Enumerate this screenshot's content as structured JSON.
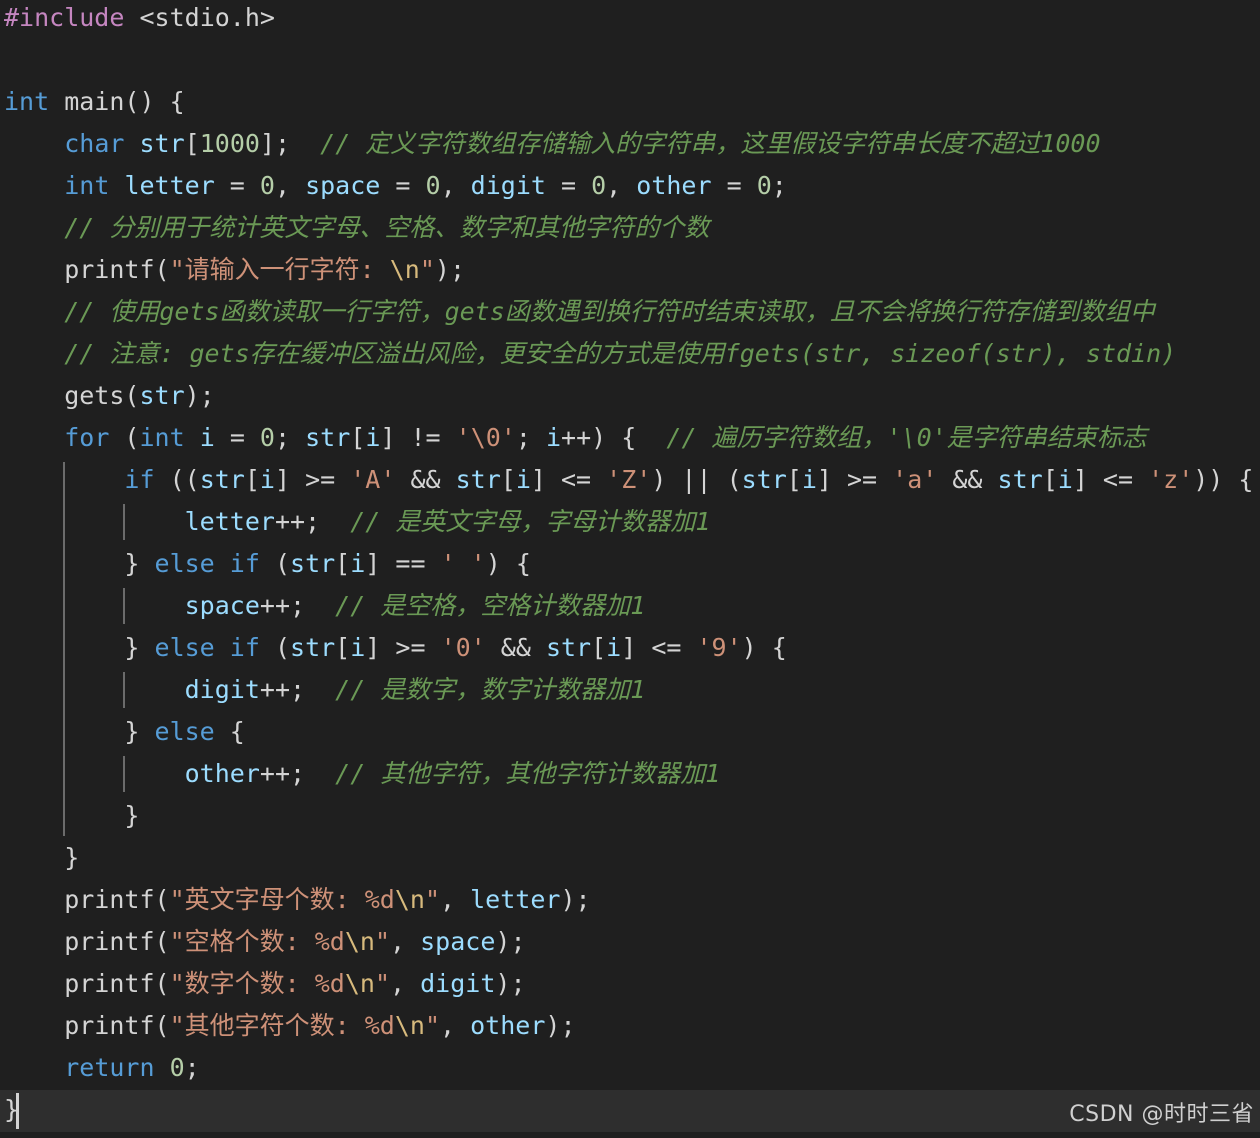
{
  "editor": {
    "lines": [
      [
        {
          "t": "#include",
          "c": "pp"
        },
        {
          "t": " ",
          "c": "plain"
        },
        {
          "t": "<stdio.h>",
          "c": "plain"
        }
      ],
      [],
      [
        {
          "t": "int",
          "c": "kw"
        },
        {
          "t": " main() ",
          "c": "plain"
        },
        {
          "t": "{",
          "c": "plain"
        }
      ],
      [
        {
          "t": "    ",
          "c": "plain"
        },
        {
          "t": "char",
          "c": "kw"
        },
        {
          "t": " ",
          "c": "plain"
        },
        {
          "t": "str",
          "c": "var"
        },
        {
          "t": "[",
          "c": "plain"
        },
        {
          "t": "1000",
          "c": "num"
        },
        {
          "t": "];  ",
          "c": "plain"
        },
        {
          "t": "// 定义字符数组存储输入的字符串，这里假设字符串长度不超过1000",
          "c": "cmt"
        }
      ],
      [
        {
          "t": "    ",
          "c": "plain"
        },
        {
          "t": "int",
          "c": "kw"
        },
        {
          "t": " ",
          "c": "plain"
        },
        {
          "t": "letter",
          "c": "var"
        },
        {
          "t": " = ",
          "c": "plain"
        },
        {
          "t": "0",
          "c": "num"
        },
        {
          "t": ", ",
          "c": "plain"
        },
        {
          "t": "space",
          "c": "var"
        },
        {
          "t": " = ",
          "c": "plain"
        },
        {
          "t": "0",
          "c": "num"
        },
        {
          "t": ", ",
          "c": "plain"
        },
        {
          "t": "digit",
          "c": "var"
        },
        {
          "t": " = ",
          "c": "plain"
        },
        {
          "t": "0",
          "c": "num"
        },
        {
          "t": ", ",
          "c": "plain"
        },
        {
          "t": "other",
          "c": "var"
        },
        {
          "t": " = ",
          "c": "plain"
        },
        {
          "t": "0",
          "c": "num"
        },
        {
          "t": ";",
          "c": "plain"
        }
      ],
      [
        {
          "t": "    ",
          "c": "plain"
        },
        {
          "t": "// 分别用于统计英文字母、空格、数字和其他字符的个数",
          "c": "cmt"
        }
      ],
      [
        {
          "t": "    printf(",
          "c": "plain"
        },
        {
          "t": "\"请输入一行字符: ",
          "c": "str"
        },
        {
          "t": "\\n",
          "c": "esc"
        },
        {
          "t": "\"",
          "c": "str"
        },
        {
          "t": ");",
          "c": "plain"
        }
      ],
      [
        {
          "t": "    ",
          "c": "plain"
        },
        {
          "t": "// 使用gets函数读取一行字符，gets函数遇到换行符时结束读取，且不会将换行符存储到数组中",
          "c": "cmt"
        }
      ],
      [
        {
          "t": "    ",
          "c": "plain"
        },
        {
          "t": "// 注意: gets存在缓冲区溢出风险，更安全的方式是使用fgets(str, sizeof(str), stdin)",
          "c": "cmt"
        }
      ],
      [
        {
          "t": "    gets(",
          "c": "plain"
        },
        {
          "t": "str",
          "c": "var"
        },
        {
          "t": ");",
          "c": "plain"
        }
      ],
      [
        {
          "t": "    ",
          "c": "plain"
        },
        {
          "t": "for",
          "c": "ctrl"
        },
        {
          "t": " (",
          "c": "plain"
        },
        {
          "t": "int",
          "c": "kw"
        },
        {
          "t": " ",
          "c": "plain"
        },
        {
          "t": "i",
          "c": "var"
        },
        {
          "t": " = ",
          "c": "plain"
        },
        {
          "t": "0",
          "c": "num"
        },
        {
          "t": "; ",
          "c": "plain"
        },
        {
          "t": "str",
          "c": "var"
        },
        {
          "t": "[",
          "c": "plain"
        },
        {
          "t": "i",
          "c": "var"
        },
        {
          "t": "] != ",
          "c": "plain"
        },
        {
          "t": "'\\0'",
          "c": "str"
        },
        {
          "t": "; ",
          "c": "plain"
        },
        {
          "t": "i",
          "c": "var"
        },
        {
          "t": "++) {  ",
          "c": "plain"
        },
        {
          "t": "// 遍历字符数组，'\\0'是字符串结束标志",
          "c": "cmt"
        }
      ],
      [
        {
          "t": "        ",
          "c": "plain"
        },
        {
          "t": "if",
          "c": "ctrl"
        },
        {
          "t": " ((",
          "c": "plain"
        },
        {
          "t": "str",
          "c": "var"
        },
        {
          "t": "[",
          "c": "plain"
        },
        {
          "t": "i",
          "c": "var"
        },
        {
          "t": "] >= ",
          "c": "plain"
        },
        {
          "t": "'A'",
          "c": "str"
        },
        {
          "t": " && ",
          "c": "plain"
        },
        {
          "t": "str",
          "c": "var"
        },
        {
          "t": "[",
          "c": "plain"
        },
        {
          "t": "i",
          "c": "var"
        },
        {
          "t": "] <= ",
          "c": "plain"
        },
        {
          "t": "'Z'",
          "c": "str"
        },
        {
          "t": ") || (",
          "c": "plain"
        },
        {
          "t": "str",
          "c": "var"
        },
        {
          "t": "[",
          "c": "plain"
        },
        {
          "t": "i",
          "c": "var"
        },
        {
          "t": "] >= ",
          "c": "plain"
        },
        {
          "t": "'a'",
          "c": "str"
        },
        {
          "t": " && ",
          "c": "plain"
        },
        {
          "t": "str",
          "c": "var"
        },
        {
          "t": "[",
          "c": "plain"
        },
        {
          "t": "i",
          "c": "var"
        },
        {
          "t": "] <= ",
          "c": "plain"
        },
        {
          "t": "'z'",
          "c": "str"
        },
        {
          "t": ")) {",
          "c": "plain"
        }
      ],
      [
        {
          "t": "            ",
          "c": "plain"
        },
        {
          "t": "letter",
          "c": "var"
        },
        {
          "t": "++;  ",
          "c": "plain"
        },
        {
          "t": "// 是英文字母，字母计数器加1",
          "c": "cmt"
        }
      ],
      [
        {
          "t": "        } ",
          "c": "plain"
        },
        {
          "t": "else",
          "c": "ctrl"
        },
        {
          "t": " ",
          "c": "plain"
        },
        {
          "t": "if",
          "c": "ctrl"
        },
        {
          "t": " (",
          "c": "plain"
        },
        {
          "t": "str",
          "c": "var"
        },
        {
          "t": "[",
          "c": "plain"
        },
        {
          "t": "i",
          "c": "var"
        },
        {
          "t": "] == ",
          "c": "plain"
        },
        {
          "t": "' '",
          "c": "str"
        },
        {
          "t": ") {",
          "c": "plain"
        }
      ],
      [
        {
          "t": "            ",
          "c": "plain"
        },
        {
          "t": "space",
          "c": "var"
        },
        {
          "t": "++;  ",
          "c": "plain"
        },
        {
          "t": "// 是空格，空格计数器加1",
          "c": "cmt"
        }
      ],
      [
        {
          "t": "        } ",
          "c": "plain"
        },
        {
          "t": "else",
          "c": "ctrl"
        },
        {
          "t": " ",
          "c": "plain"
        },
        {
          "t": "if",
          "c": "ctrl"
        },
        {
          "t": " (",
          "c": "plain"
        },
        {
          "t": "str",
          "c": "var"
        },
        {
          "t": "[",
          "c": "plain"
        },
        {
          "t": "i",
          "c": "var"
        },
        {
          "t": "] >= ",
          "c": "plain"
        },
        {
          "t": "'0'",
          "c": "str"
        },
        {
          "t": " && ",
          "c": "plain"
        },
        {
          "t": "str",
          "c": "var"
        },
        {
          "t": "[",
          "c": "plain"
        },
        {
          "t": "i",
          "c": "var"
        },
        {
          "t": "] <= ",
          "c": "plain"
        },
        {
          "t": "'9'",
          "c": "str"
        },
        {
          "t": ") {",
          "c": "plain"
        }
      ],
      [
        {
          "t": "            ",
          "c": "plain"
        },
        {
          "t": "digit",
          "c": "var"
        },
        {
          "t": "++;  ",
          "c": "plain"
        },
        {
          "t": "// 是数字，数字计数器加1",
          "c": "cmt"
        }
      ],
      [
        {
          "t": "        } ",
          "c": "plain"
        },
        {
          "t": "else",
          "c": "ctrl"
        },
        {
          "t": " {",
          "c": "plain"
        }
      ],
      [
        {
          "t": "            ",
          "c": "plain"
        },
        {
          "t": "other",
          "c": "var"
        },
        {
          "t": "++;  ",
          "c": "plain"
        },
        {
          "t": "// 其他字符，其他字符计数器加1",
          "c": "cmt"
        }
      ],
      [
        {
          "t": "        }",
          "c": "plain"
        }
      ],
      [
        {
          "t": "    }",
          "c": "plain"
        }
      ],
      [
        {
          "t": "    printf(",
          "c": "plain"
        },
        {
          "t": "\"英文字母个数: %d",
          "c": "str"
        },
        {
          "t": "\\n",
          "c": "esc"
        },
        {
          "t": "\"",
          "c": "str"
        },
        {
          "t": ", ",
          "c": "plain"
        },
        {
          "t": "letter",
          "c": "var"
        },
        {
          "t": ");",
          "c": "plain"
        }
      ],
      [
        {
          "t": "    printf(",
          "c": "plain"
        },
        {
          "t": "\"空格个数: %d",
          "c": "str"
        },
        {
          "t": "\\n",
          "c": "esc"
        },
        {
          "t": "\"",
          "c": "str"
        },
        {
          "t": ", ",
          "c": "plain"
        },
        {
          "t": "space",
          "c": "var"
        },
        {
          "t": ");",
          "c": "plain"
        }
      ],
      [
        {
          "t": "    printf(",
          "c": "plain"
        },
        {
          "t": "\"数字个数: %d",
          "c": "str"
        },
        {
          "t": "\\n",
          "c": "esc"
        },
        {
          "t": "\"",
          "c": "str"
        },
        {
          "t": ", ",
          "c": "plain"
        },
        {
          "t": "digit",
          "c": "var"
        },
        {
          "t": ");",
          "c": "plain"
        }
      ],
      [
        {
          "t": "    printf(",
          "c": "plain"
        },
        {
          "t": "\"其他字符个数: %d",
          "c": "str"
        },
        {
          "t": "\\n",
          "c": "esc"
        },
        {
          "t": "\"",
          "c": "str"
        },
        {
          "t": ", ",
          "c": "plain"
        },
        {
          "t": "other",
          "c": "var"
        },
        {
          "t": ");",
          "c": "plain"
        }
      ],
      [
        {
          "t": "    ",
          "c": "plain"
        },
        {
          "t": "return",
          "c": "ctrl"
        },
        {
          "t": " ",
          "c": "plain"
        },
        {
          "t": "0",
          "c": "num"
        },
        {
          "t": ";",
          "c": "plain"
        }
      ],
      [
        {
          "t": "}",
          "c": "plain"
        }
      ]
    ]
  },
  "watermark": {
    "text": "CSDN @时时三省"
  },
  "colors": {
    "background": "#1f1f1f",
    "keyword": "#569cd6",
    "variable": "#9cdcfe",
    "string": "#ce9178",
    "number": "#b5cea8",
    "comment": "#6a9955",
    "preprocessor": "#c586c0"
  }
}
